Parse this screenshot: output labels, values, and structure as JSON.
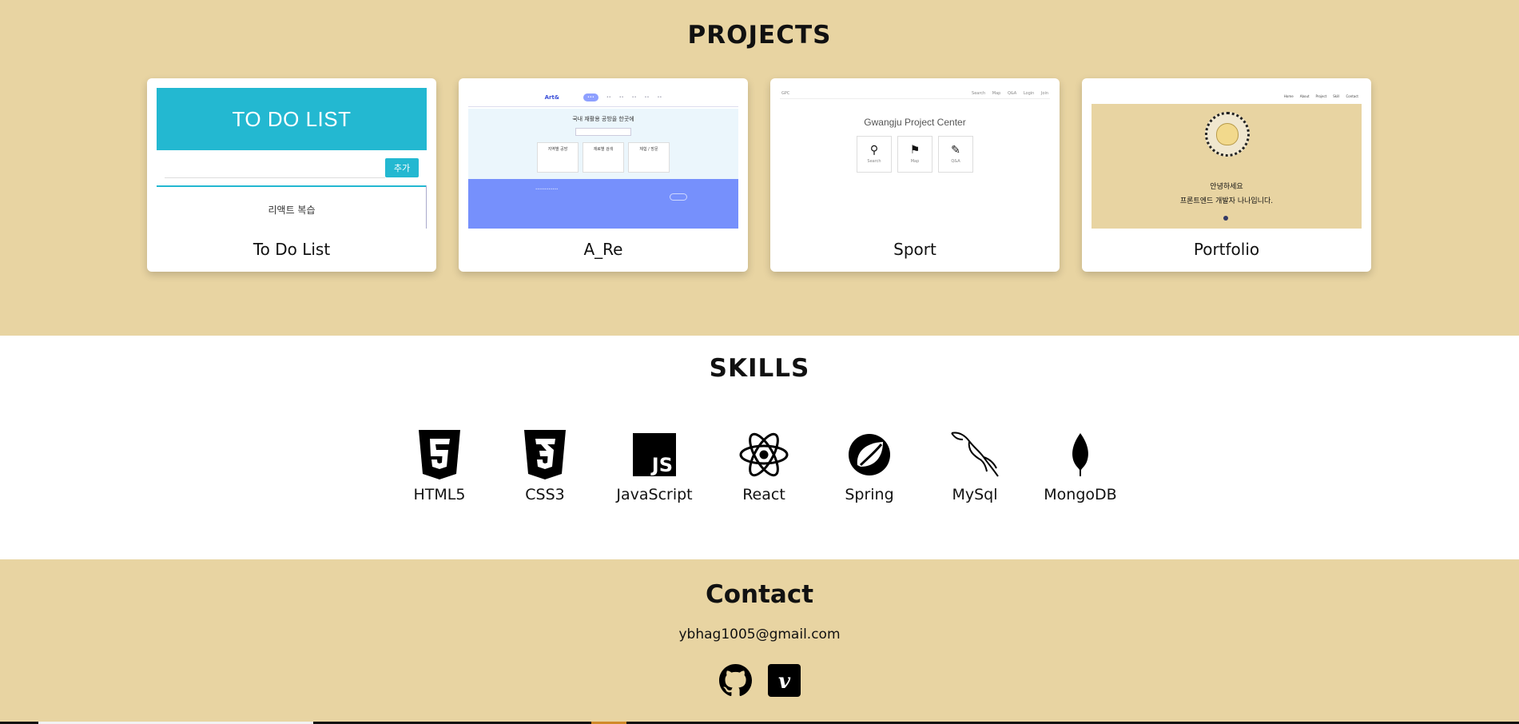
{
  "projects": {
    "title": "PROJECTS",
    "cards": [
      {
        "label": "To Do List",
        "thumb": {
          "header": "TO DO LIST",
          "add_button": "추가",
          "item": "리액트 복습"
        }
      },
      {
        "label": "A_Re",
        "thumb": {
          "logo": "Art&",
          "hero_title": "국내 재활용 공방을 한곳에",
          "box1": "지역별 공방",
          "box2": "재료별 검색",
          "box3": "체험 / 방문"
        }
      },
      {
        "label": "Sport",
        "thumb": {
          "brand": "GPC",
          "nav": [
            "Search",
            "Map",
            "Q&A",
            "Login",
            "Join"
          ],
          "title": "Gwangju Project Center",
          "icons": [
            "Search",
            "Map",
            "Q&A"
          ]
        }
      },
      {
        "label": "Portfolio",
        "thumb": {
          "nav": [
            "Home",
            "About",
            "Project",
            "Skill",
            "Contact"
          ],
          "line1": "안녕하세요",
          "line2": "프론트엔드 개발자 나나입니다."
        }
      }
    ]
  },
  "skills": {
    "title": "SKILLS",
    "items": [
      {
        "label": "HTML5",
        "icon": "html5-icon"
      },
      {
        "label": "CSS3",
        "icon": "css3-icon"
      },
      {
        "label": "JavaScript",
        "icon": "javascript-icon"
      },
      {
        "label": "React",
        "icon": "react-icon"
      },
      {
        "label": "Spring",
        "icon": "spring-icon"
      },
      {
        "label": "MySql",
        "icon": "mysql-icon"
      },
      {
        "label": "MongoDB",
        "icon": "mongodb-icon"
      }
    ]
  },
  "contact": {
    "title": "Contact",
    "email": "ybhag1005@gmail.com",
    "socials": [
      {
        "icon": "github-icon"
      },
      {
        "icon": "vimeo-icon"
      }
    ]
  },
  "colors": {
    "section_bg": "#e8d4a2",
    "todo_accent": "#23b8d1",
    "are_blue": "#7690fc",
    "text": "#111111"
  }
}
